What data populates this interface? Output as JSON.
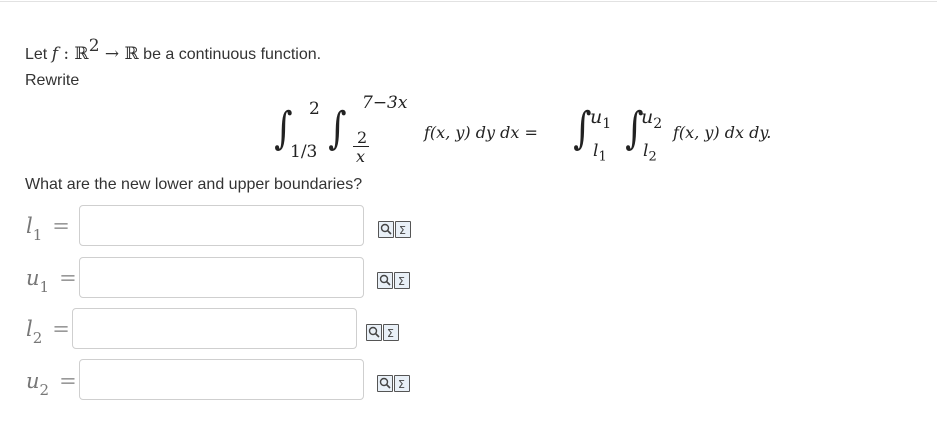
{
  "intro": {
    "prefix": "Let",
    "f": "f",
    "colon_space": " : ",
    "domain": "ℝ",
    "domain_exp": "2",
    "arrow": " → ",
    "codomain": "ℝ",
    "rest": " be a continuous function."
  },
  "rewrite_label": "Rewrite",
  "integral_left": {
    "outer_lower": "1/3",
    "outer_upper": "2",
    "inner_lower_num": "2",
    "inner_lower_den": "x",
    "inner_upper": "7−3x",
    "integrand": "f(x, y) dy dx ="
  },
  "integral_right": {
    "outer_lower": "l",
    "outer_lower_sub": "1",
    "outer_upper": "u",
    "outer_upper_sub": "1",
    "inner_lower": "l",
    "inner_lower_sub": "2",
    "inner_upper": "u",
    "inner_upper_sub": "2",
    "integrand": "f(x, y) dx dy."
  },
  "question": "What are the new lower and upper boundaries?",
  "answers": [
    {
      "var": "l",
      "sub": "1",
      "eq": "=",
      "value": "",
      "placeholder": ""
    },
    {
      "var": "u",
      "sub": "1",
      "eq": "=",
      "value": "",
      "placeholder": ""
    },
    {
      "var": "l",
      "sub": "2",
      "eq": "=",
      "value": "",
      "placeholder": ""
    },
    {
      "var": "u",
      "sub": "2",
      "eq": "=",
      "value": "",
      "placeholder": ""
    }
  ],
  "icons": [
    "preview-icon",
    "equation-editor-icon"
  ]
}
